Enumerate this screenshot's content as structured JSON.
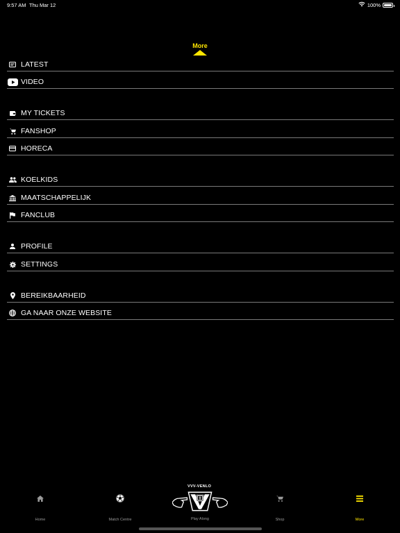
{
  "status": {
    "time": "9:57 AM",
    "date": "Thu Mar 12",
    "battery": "100%",
    "battery_level": 1.0
  },
  "header": {
    "title": "More"
  },
  "menu": [
    {
      "label": "LATEST",
      "icon": "news-card-icon"
    },
    {
      "label": "VIDEO",
      "icon": "youtube-icon"
    },
    {
      "label": "MY TICKETS",
      "icon": "wallet-icon"
    },
    {
      "label": "FANSHOP",
      "icon": "cart-icon"
    },
    {
      "label": "HORECA",
      "icon": "credit-card-icon"
    },
    {
      "label": "KOELKIDS",
      "icon": "group-icon"
    },
    {
      "label": "MAATSCHAPPELIJK",
      "icon": "institution-icon"
    },
    {
      "label": "FANCLUB",
      "icon": "flag-icon"
    },
    {
      "label": "PROFILE",
      "icon": "person-icon"
    },
    {
      "label": "SETTINGS",
      "icon": "gear-icon"
    },
    {
      "label": "BEREIKBAARHEID",
      "icon": "location-pin-icon"
    },
    {
      "label": "GA NAAR ONZE WEBSITE",
      "icon": "globe-icon"
    }
  ],
  "tabs": [
    {
      "label": "Home",
      "icon": "home-icon"
    },
    {
      "label": "Match Centre",
      "icon": "soccer-ball-icon"
    },
    {
      "label": "Play Along",
      "icon": "vvv-venlo-logo"
    },
    {
      "label": "Shop",
      "icon": "cart-icon"
    },
    {
      "label": "More",
      "icon": "menu-icon"
    }
  ],
  "logo": {
    "text": "VVV-VENLO"
  },
  "colors": {
    "accent": "#ffe600",
    "background": "#000000",
    "divider": "#7a7a7a",
    "inactive": "#9a9a9a"
  }
}
